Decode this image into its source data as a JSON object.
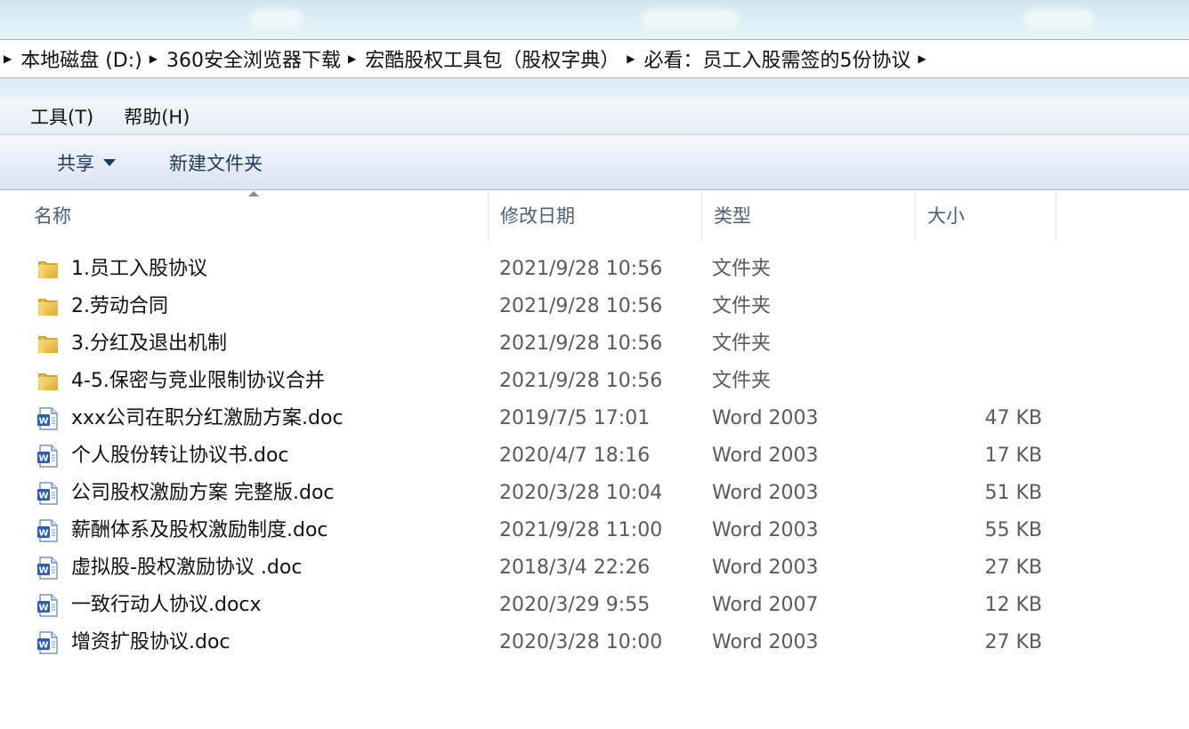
{
  "breadcrumb": [
    "本地磁盘 (D:)",
    "360安全浏览器下载",
    "宏酷股权工具包（股权字典）",
    "必看：员工入股需签的5份协议"
  ],
  "menu": {
    "tools": "工具(T)",
    "help": "帮助(H)"
  },
  "toolbar": {
    "share": "共享",
    "new_folder": "新建文件夹"
  },
  "columns": {
    "name": "名称",
    "date": "修改日期",
    "type": "类型",
    "size": "大小"
  },
  "files": [
    {
      "icon": "folder-icon",
      "name": "1.员工入股协议",
      "date": "2021/9/28 10:56",
      "type": "文件夹",
      "size": ""
    },
    {
      "icon": "folder-icon",
      "name": "2.劳动合同",
      "date": "2021/9/28 10:56",
      "type": "文件夹",
      "size": ""
    },
    {
      "icon": "folder-icon",
      "name": "3.分红及退出机制",
      "date": "2021/9/28 10:56",
      "type": "文件夹",
      "size": ""
    },
    {
      "icon": "folder-icon",
      "name": "4-5.保密与竞业限制协议合并",
      "date": "2021/9/28 10:56",
      "type": "文件夹",
      "size": ""
    },
    {
      "icon": "word-doc-icon",
      "name": "xxx公司在职分红激励方案.doc",
      "date": "2019/7/5 17:01",
      "type": "Word 2003",
      "size": "47 KB"
    },
    {
      "icon": "word-doc-icon",
      "name": "个人股份转让协议书.doc",
      "date": "2020/4/7 18:16",
      "type": "Word 2003",
      "size": "17 KB"
    },
    {
      "icon": "word-doc-icon",
      "name": "公司股权激励方案 完整版.doc",
      "date": "2020/3/28 10:04",
      "type": "Word 2003",
      "size": "51 KB"
    },
    {
      "icon": "word-doc-icon",
      "name": "薪酬体系及股权激励制度.doc",
      "date": "2021/9/28 11:00",
      "type": "Word 2003",
      "size": "55 KB"
    },
    {
      "icon": "word-doc-icon",
      "name": "虚拟股-股权激励协议 .doc",
      "date": "2018/3/4 22:26",
      "type": "Word 2003",
      "size": "27 KB"
    },
    {
      "icon": "word-doc-icon",
      "name": "一致行动人协议.docx",
      "date": "2020/3/29 9:55",
      "type": "Word 2007",
      "size": "12 KB"
    },
    {
      "icon": "word-doc-icon",
      "name": "增资扩股协议.doc",
      "date": "2020/3/28 10:00",
      "type": "Word 2003",
      "size": "27 KB"
    }
  ]
}
